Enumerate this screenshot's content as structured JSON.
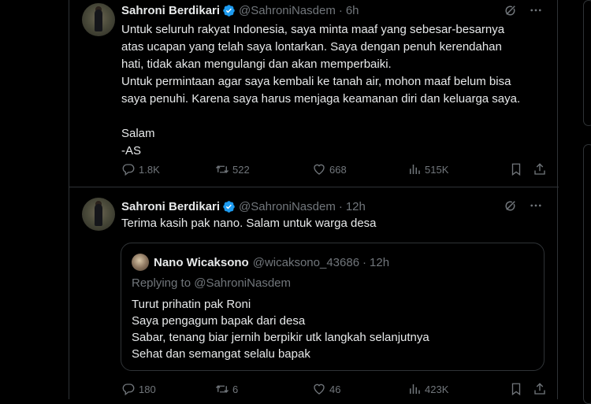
{
  "tweets": [
    {
      "author_name": "Sahroni Berdikari",
      "handle": "@SahroniNasdem",
      "separator": "·",
      "time": "6h",
      "text": "Untuk seluruh rakyat Indonesia, saya minta maaf yang sebesar-besarnya\natas ucapan yang telah saya lontarkan. Saya dengan penuh kerendahan\nhati, tidak akan mengulangi dan akan memperbaiki.\nUntuk permintaan agar saya kembali ke tanah air, mohon maaf belum bisa\nsaya penuhi. Karena saya harus menjaga keamanan diri dan keluarga saya.\n\nSalam\n-AS",
      "replies": "1.8K",
      "reposts": "522",
      "likes": "668",
      "views": "515K"
    },
    {
      "author_name": "Sahroni Berdikari",
      "handle": "@SahroniNasdem",
      "separator": "·",
      "time": "12h",
      "text": "Terima kasih pak nano. Salam untuk warga desa",
      "replies": "180",
      "reposts": "6",
      "likes": "46",
      "views": "423K",
      "quote": {
        "author_name": "Nano Wicaksono",
        "handle": "@wicaksono_43686",
        "separator": "·",
        "time": "12h",
        "replying_to": "Replying to @SahroniNasdem",
        "text": "Turut prihatin pak Roni\nSaya pengagum bapak dari desa\nSabar, tenang biar jernih berpikir utk langkah selanjutnya\nSehat dan semangat selalu bapak"
      }
    }
  ],
  "icons": {
    "verified": "verified-badge-icon",
    "grok": "grok-icon",
    "more": "more-icon",
    "reply": "reply-icon",
    "repost": "repost-icon",
    "like": "heart-icon",
    "views": "views-icon",
    "bookmark": "bookmark-icon",
    "share": "share-icon"
  },
  "colors": {
    "background": "#000000",
    "text": "#e7e9ea",
    "muted": "#71767b",
    "border": "#2f3336",
    "verified": "#1d9bf0"
  }
}
